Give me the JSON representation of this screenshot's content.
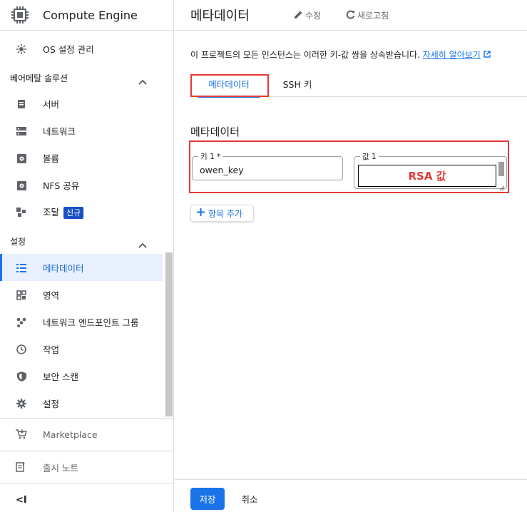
{
  "app": {
    "title": "Compute Engine"
  },
  "sidebar": {
    "top_items": [
      {
        "label": "OS 설정 관리",
        "icon": "os-settings-icon"
      }
    ],
    "bare_metal": {
      "header": "베어메탈 솔루션",
      "items": [
        {
          "label": "서버",
          "icon": "server-icon"
        },
        {
          "label": "네트워크",
          "icon": "network-icon"
        },
        {
          "label": "볼륨",
          "icon": "volume-icon"
        },
        {
          "label": "NFS 공유",
          "icon": "nfs-share-icon"
        },
        {
          "label": "조달",
          "icon": "procurement-icon",
          "badge": "신규"
        }
      ]
    },
    "settings": {
      "header": "설정",
      "items": [
        {
          "label": "메타데이터",
          "icon": "metadata-list-icon",
          "active": true
        },
        {
          "label": "영역",
          "icon": "zones-icon"
        },
        {
          "label": "네트워크 엔드포인트 그룹",
          "icon": "endpoint-group-icon"
        },
        {
          "label": "작업",
          "icon": "clock-icon"
        },
        {
          "label": "보안 스캔",
          "icon": "shield-icon"
        },
        {
          "label": "설정",
          "icon": "gear-icon"
        }
      ]
    },
    "marketplace": "Marketplace",
    "release_notes": "출시 노트",
    "collapse": "<I"
  },
  "header": {
    "title": "메타데이터",
    "edit_label": "수정",
    "refresh_label": "새로고침"
  },
  "main": {
    "description": "이 프로젝트의 모든 인스턴스는 이러한 키-값 쌍을 상속받습니다.",
    "learn_more": "자세히 알아보기",
    "tabs": [
      {
        "label": "메타데이터",
        "active": true
      },
      {
        "label": "SSH 키",
        "active": false
      }
    ],
    "section_title": "메타데이터",
    "key_field": {
      "label": "키 1 *",
      "value": "owen_key"
    },
    "value_field": {
      "label": "값 1",
      "annotation": "RSA 값"
    },
    "add_item": "항목 추가"
  },
  "footer": {
    "save": "저장",
    "cancel": "취소"
  },
  "colors": {
    "accent": "#1a73e8",
    "highlight": "#e53935",
    "badge": "#1a4fc4"
  }
}
